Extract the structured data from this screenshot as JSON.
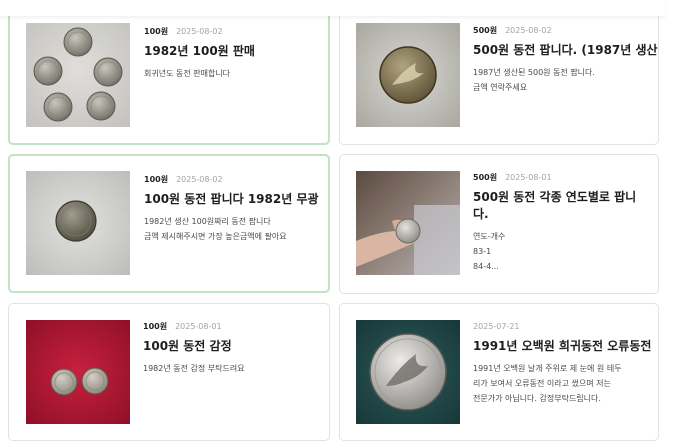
{
  "listings": [
    {
      "category": "100원",
      "date": "2025-08-02",
      "title": "1982년 100원 판매",
      "desc": [
        "회귀년도 동전 판매합니다"
      ]
    },
    {
      "category": "500원",
      "date": "2025-08-02",
      "title": "500원 동전 팝니다. (1987년 생산",
      "desc": [
        "1987년 생산된 500원 동전 팝니다.",
        "금액 연락주세요"
      ]
    },
    {
      "category": "100원",
      "date": "2025-08-02",
      "title": "100원 동전 팝니다 1982년 무광",
      "desc": [
        "1982년 생산 100원짜리 동전 팝니다",
        "금액 제시해주시면 가장 높은금액에 팔아요"
      ]
    },
    {
      "category": "500원",
      "date": "2025-08-01",
      "title": "500원 동전 각종 연도별로 팝니다.",
      "desc": [
        "연도-개수",
        "83-1",
        "84-4..."
      ]
    },
    {
      "category": "100원",
      "date": "2025-08-01",
      "title": "100원 동전 감정",
      "desc": [
        "1982년 동전 감정 부탁드려요"
      ]
    },
    {
      "category": "",
      "date": "2025-07-21",
      "title": "1991년 오백원 희귀동전 오류동전",
      "desc": [
        "1991년 오백원 날개 주위로 제 눈에 원 테두",
        "리가 보여서 오류동전 이라고 썼으며 저는",
        "전문가가 아닙니다. 감정부탁드립니다."
      ]
    }
  ]
}
